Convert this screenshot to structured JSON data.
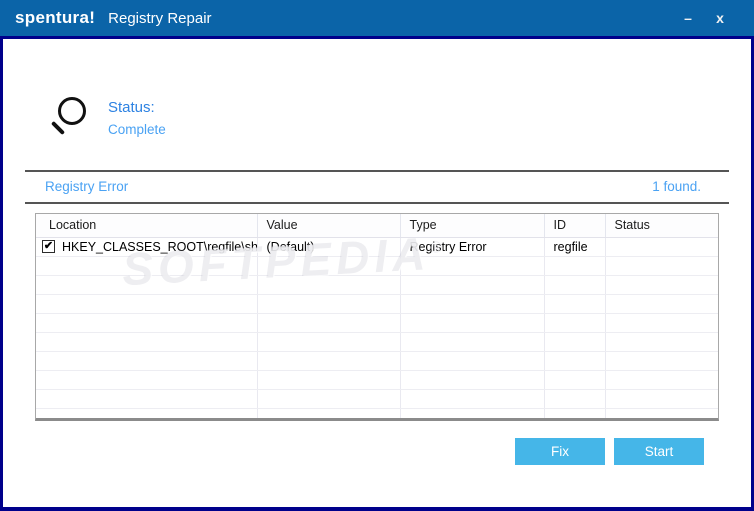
{
  "colors": {
    "titlebar_blue": "#0b64a8",
    "window_border_navy": "#00008b",
    "status_label_blue": "#2d82e2",
    "link_blue": "#4aa2f3",
    "button_blue": "#45b6e8"
  },
  "titlebar": {
    "logo": "spentura!",
    "app_title": "Registry Repair",
    "minimize_glyph": "–",
    "close_glyph": "x"
  },
  "status": {
    "label": "Status:",
    "value": "Complete"
  },
  "results_bar": {
    "category": "Registry Error",
    "count_text": "1 found."
  },
  "table": {
    "columns": [
      "Location",
      "Value",
      "Type",
      "ID",
      "Status"
    ],
    "rows": [
      {
        "checked": true,
        "checkbox_glyph": "✔",
        "location": "HKEY_CLASSES_ROOT\\regfile\\sh...",
        "value": "(Default)",
        "type": "Registry Error",
        "id": "regfile",
        "status": ""
      }
    ]
  },
  "watermark": {
    "text": "SOFTPEDIA",
    "reg": "®"
  },
  "buttons": {
    "fix": "Fix",
    "start": "Start"
  }
}
